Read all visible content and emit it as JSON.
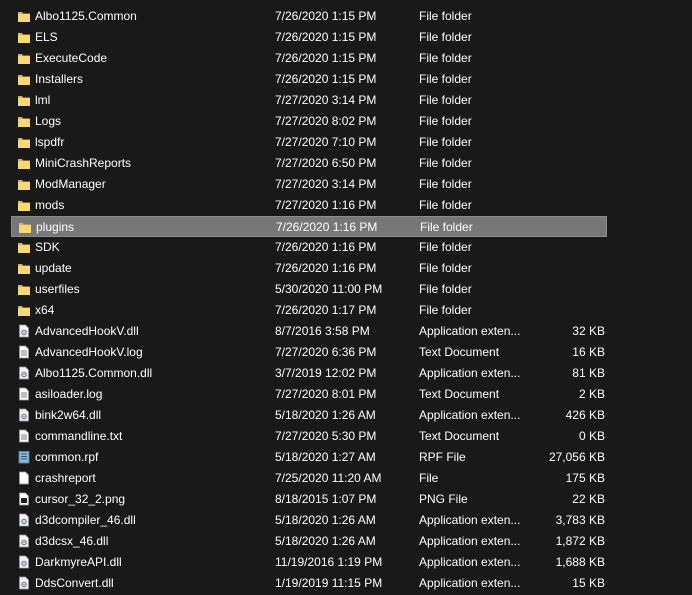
{
  "file_list": {
    "selected_index": 10,
    "rows": [
      {
        "name": "Albo1125.Common",
        "date": "7/26/2020 1:15 PM",
        "type": "File folder",
        "size": "",
        "icon": "folder-icon"
      },
      {
        "name": "ELS",
        "date": "7/26/2020 1:15 PM",
        "type": "File folder",
        "size": "",
        "icon": "folder-icon"
      },
      {
        "name": "ExecuteCode",
        "date": "7/26/2020 1:15 PM",
        "type": "File folder",
        "size": "",
        "icon": "folder-icon"
      },
      {
        "name": "Installers",
        "date": "7/26/2020 1:15 PM",
        "type": "File folder",
        "size": "",
        "icon": "folder-icon"
      },
      {
        "name": "lml",
        "date": "7/27/2020 3:14 PM",
        "type": "File folder",
        "size": "",
        "icon": "folder-icon"
      },
      {
        "name": "Logs",
        "date": "7/27/2020 8:02 PM",
        "type": "File folder",
        "size": "",
        "icon": "folder-icon"
      },
      {
        "name": "lspdfr",
        "date": "7/27/2020 7:10 PM",
        "type": "File folder",
        "size": "",
        "icon": "folder-icon"
      },
      {
        "name": "MiniCrashReports",
        "date": "7/27/2020 6:50 PM",
        "type": "File folder",
        "size": "",
        "icon": "folder-icon"
      },
      {
        "name": "ModManager",
        "date": "7/27/2020 3:14 PM",
        "type": "File folder",
        "size": "",
        "icon": "folder-icon"
      },
      {
        "name": "mods",
        "date": "7/27/2020 1:16 PM",
        "type": "File folder",
        "size": "",
        "icon": "folder-icon"
      },
      {
        "name": "plugins",
        "date": "7/26/2020 1:16 PM",
        "type": "File folder",
        "size": "",
        "icon": "folder-icon"
      },
      {
        "name": "SDK",
        "date": "7/26/2020 1:16 PM",
        "type": "File folder",
        "size": "",
        "icon": "folder-icon"
      },
      {
        "name": "update",
        "date": "7/26/2020 1:16 PM",
        "type": "File folder",
        "size": "",
        "icon": "folder-icon"
      },
      {
        "name": "userfiles",
        "date": "5/30/2020 11:00 PM",
        "type": "File folder",
        "size": "",
        "icon": "folder-icon"
      },
      {
        "name": "x64",
        "date": "7/26/2020 1:17 PM",
        "type": "File folder",
        "size": "",
        "icon": "folder-icon"
      },
      {
        "name": "AdvancedHookV.dll",
        "date": "8/7/2016 3:58 PM",
        "type": "Application exten...",
        "size": "32 KB",
        "icon": "dll-file-icon"
      },
      {
        "name": "AdvancedHookV.log",
        "date": "7/27/2020 6:36 PM",
        "type": "Text Document",
        "size": "16 KB",
        "icon": "text-file-icon"
      },
      {
        "name": "Albo1125.Common.dll",
        "date": "3/7/2019 12:02 PM",
        "type": "Application exten...",
        "size": "81 KB",
        "icon": "dll-file-icon"
      },
      {
        "name": "asiloader.log",
        "date": "7/27/2020 8:01 PM",
        "type": "Text Document",
        "size": "2 KB",
        "icon": "text-file-icon"
      },
      {
        "name": "bink2w64.dll",
        "date": "5/18/2020 1:26 AM",
        "type": "Application exten...",
        "size": "426 KB",
        "icon": "dll-file-icon"
      },
      {
        "name": "commandline.txt",
        "date": "7/27/2020 5:30 PM",
        "type": "Text Document",
        "size": "0 KB",
        "icon": "text-file-icon"
      },
      {
        "name": "common.rpf",
        "date": "5/18/2020 1:27 AM",
        "type": "RPF File",
        "size": "27,056 KB",
        "icon": "rpf-file-icon"
      },
      {
        "name": "crashreport",
        "date": "7/25/2020 11:20 AM",
        "type": "File",
        "size": "175 KB",
        "icon": "blank-file-icon"
      },
      {
        "name": "cursor_32_2.png",
        "date": "8/18/2015 1:07 PM",
        "type": "PNG File",
        "size": "22 KB",
        "icon": "image-file-icon"
      },
      {
        "name": "d3dcompiler_46.dll",
        "date": "5/18/2020 1:26 AM",
        "type": "Application exten...",
        "size": "3,783 KB",
        "icon": "dll-file-icon"
      },
      {
        "name": "d3dcsx_46.dll",
        "date": "5/18/2020 1:26 AM",
        "type": "Application exten...",
        "size": "1,872 KB",
        "icon": "dll-file-icon"
      },
      {
        "name": "DarkmyreAPI.dll",
        "date": "11/19/2016 1:19 PM",
        "type": "Application exten...",
        "size": "1,688 KB",
        "icon": "dll-file-icon"
      },
      {
        "name": "DdsConvert.dll",
        "date": "1/19/2019 11:15 PM",
        "type": "Application exten...",
        "size": "15 KB",
        "icon": "dll-file-icon"
      }
    ]
  }
}
